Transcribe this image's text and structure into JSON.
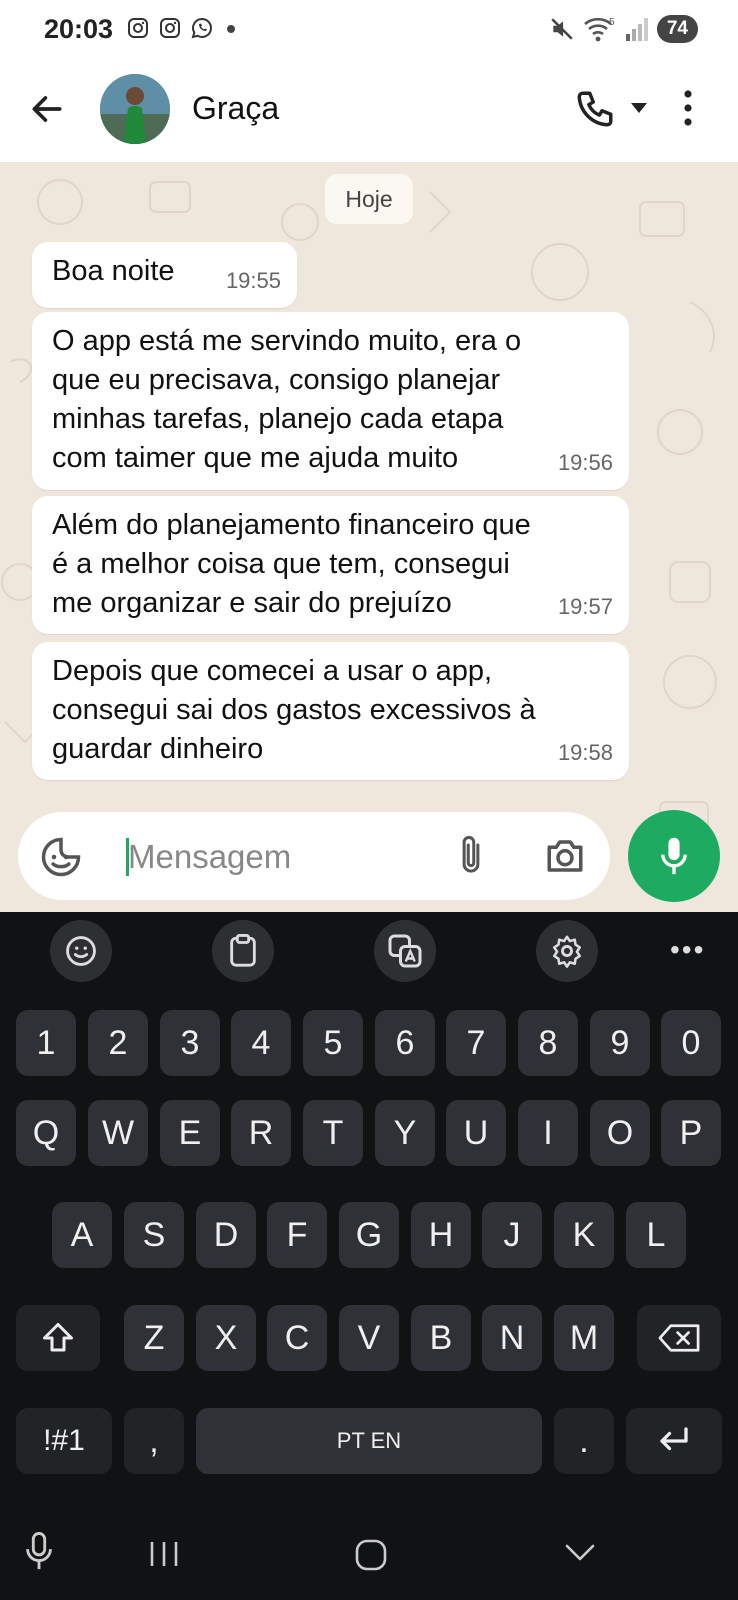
{
  "status_bar": {
    "time": "20:03",
    "battery": "74",
    "wifi_tag": "5"
  },
  "contact": {
    "name": "Graça"
  },
  "date_chip": "Hoje",
  "messages": [
    {
      "text": "Boa noite",
      "time": "19:55"
    },
    {
      "text": "O app está me servindo muito, era o\nque eu precisava, consigo planejar\nminhas tarefas, planejo cada etapa\ncom taimer que me ajuda muito",
      "time": "19:56"
    },
    {
      "text": "Além do planejamento financeiro que\né a melhor coisa que tem, consegui\nme organizar e sair do prejuízo",
      "time": "19:57"
    },
    {
      "text": "Depois que comecei a usar o app,\nconsegui sai dos gastos excessivos à\nguardar dinheiro",
      "time": "19:58"
    }
  ],
  "composer": {
    "placeholder": "Mensagem"
  },
  "keyboard": {
    "row_numbers": [
      "1",
      "2",
      "3",
      "4",
      "5",
      "6",
      "7",
      "8",
      "9",
      "0"
    ],
    "row_q": [
      "Q",
      "W",
      "E",
      "R",
      "T",
      "Y",
      "U",
      "I",
      "O",
      "P"
    ],
    "row_a": [
      "A",
      "S",
      "D",
      "F",
      "G",
      "H",
      "J",
      "K",
      "L"
    ],
    "row_z": [
      "Z",
      "X",
      "C",
      "V",
      "B",
      "N",
      "M"
    ],
    "symbols": "!#1",
    "comma": ",",
    "space_label": "PT EN",
    "period": "."
  },
  "colors": {
    "accent_green": "#1daa61",
    "chat_bg": "#efe7dc",
    "keyboard_bg": "#111214"
  }
}
